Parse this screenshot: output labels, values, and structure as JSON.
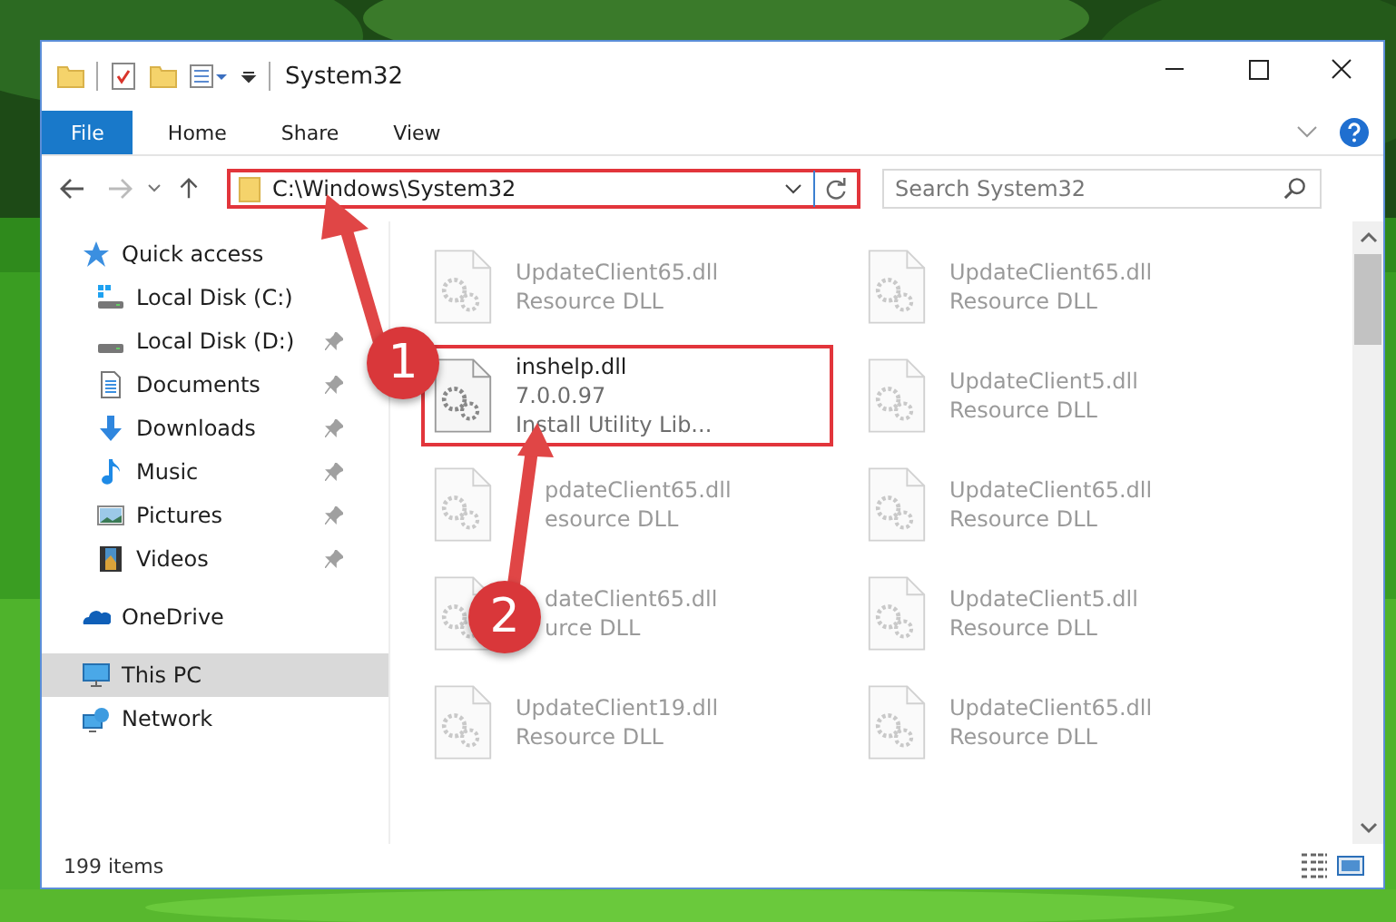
{
  "window": {
    "title": "System32"
  },
  "ribbon": {
    "tabs": [
      {
        "label": "File",
        "kind": "file"
      },
      {
        "label": "Home",
        "kind": "tab"
      },
      {
        "label": "Share",
        "kind": "tab"
      },
      {
        "label": "View",
        "kind": "tab"
      }
    ]
  },
  "address_bar": {
    "path": "C:\\Windows\\System32",
    "highlighted": true
  },
  "search": {
    "placeholder": "Search System32"
  },
  "sidebar": {
    "items": [
      {
        "label": "Quick access",
        "kind": "star",
        "selected": false,
        "children": [
          {
            "label": "Local Disk (C:)",
            "kind": "system-drive",
            "pinned": false,
            "selected": false
          },
          {
            "label": "Local Disk (D:)",
            "kind": "drive",
            "pinned": true,
            "selected": false
          },
          {
            "label": "Documents",
            "kind": "documents",
            "pinned": true,
            "selected": false
          },
          {
            "label": "Downloads",
            "kind": "downloads",
            "pinned": true,
            "selected": false
          },
          {
            "label": "Music",
            "kind": "music",
            "pinned": true,
            "selected": false
          },
          {
            "label": "Pictures",
            "kind": "pictures",
            "pinned": true,
            "selected": false
          },
          {
            "label": "Videos",
            "kind": "videos",
            "pinned": true,
            "selected": false
          }
        ]
      },
      {
        "label": "OneDrive",
        "kind": "cloud",
        "selected": false
      },
      {
        "label": "This PC",
        "kind": "pc",
        "selected": true
      },
      {
        "label": "Network",
        "kind": "network",
        "selected": false
      }
    ]
  },
  "files": [
    {
      "name": "UpdateClient65.dll",
      "details": [
        "Resource DLL"
      ],
      "blurred": true,
      "highlighted": false
    },
    {
      "name": "UpdateClient65.dll",
      "details": [
        "Resource DLL"
      ],
      "blurred": true,
      "highlighted": false
    },
    {
      "name": "inshelp.dll",
      "details": [
        "7.0.0.97",
        "Install Utility Lib..."
      ],
      "blurred": false,
      "highlighted": true
    },
    {
      "name": "UpdateClient5.dll",
      "details": [
        "Resource DLL"
      ],
      "blurred": true,
      "highlighted": false
    },
    {
      "name": "pdateClient65.dll",
      "details": [
        "esource DLL"
      ],
      "blurred": true,
      "highlighted": false,
      "covered": true
    },
    {
      "name": "UpdateClient65.dll",
      "details": [
        "Resource DLL"
      ],
      "blurred": true,
      "highlighted": false
    },
    {
      "name": "dateClient65.dll",
      "details": [
        "urce DLL"
      ],
      "blurred": true,
      "highlighted": false,
      "covered": true
    },
    {
      "name": "UpdateClient5.dll",
      "details": [
        "Resource DLL"
      ],
      "blurred": true,
      "highlighted": false
    },
    {
      "name": "UpdateClient19.dll",
      "details": [
        "Resource DLL"
      ],
      "blurred": true,
      "highlighted": false
    },
    {
      "name": "UpdateClient65.dll",
      "details": [
        "Resource DLL"
      ],
      "blurred": true,
      "highlighted": false
    }
  ],
  "status_bar": {
    "item_count": "199 items"
  },
  "annotations": [
    {
      "number": "1"
    },
    {
      "number": "2"
    }
  ]
}
